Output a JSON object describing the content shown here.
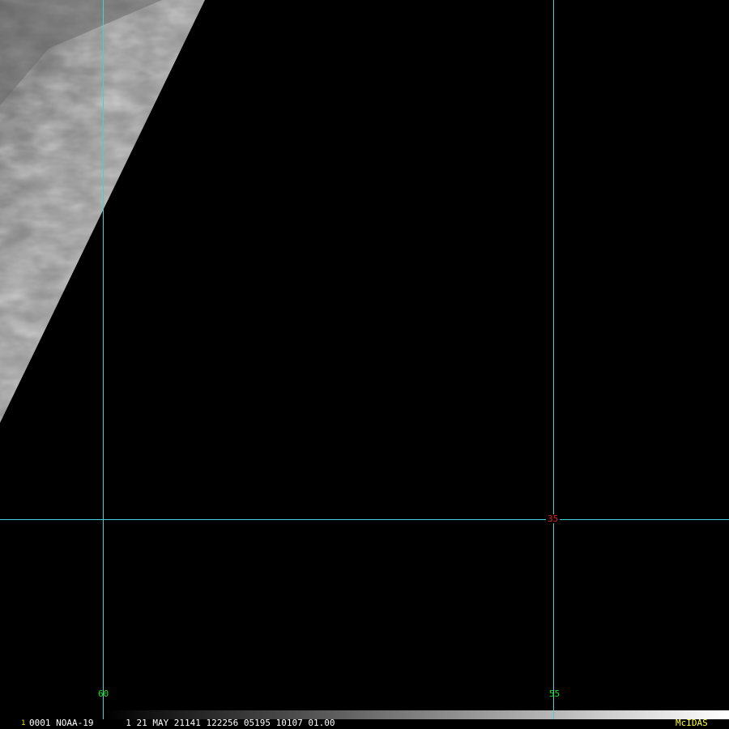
{
  "image": {
    "satellite": "NOAA-19",
    "background_color": "#000000",
    "swath_note": "grayscale infrared imagery visible only in upper-left wedge"
  },
  "grid": {
    "color": "#3fd4cf",
    "longitudes": [
      {
        "label": "60",
        "label_color": "#22dd22"
      },
      {
        "label": "55",
        "label_color": "#22dd22"
      }
    ],
    "latitudes": [
      {
        "label": "35",
        "label_color": "#dd2222"
      }
    ]
  },
  "footer": {
    "frame_number": "1",
    "frame_color": "#e8e800",
    "info_text": "0001 NOAA-19      1 21 MAY 21141 122256 05195 10107 01.00",
    "info_color": "#ffffff",
    "brand": "McIDAS",
    "brand_color": "#ffff33"
  }
}
